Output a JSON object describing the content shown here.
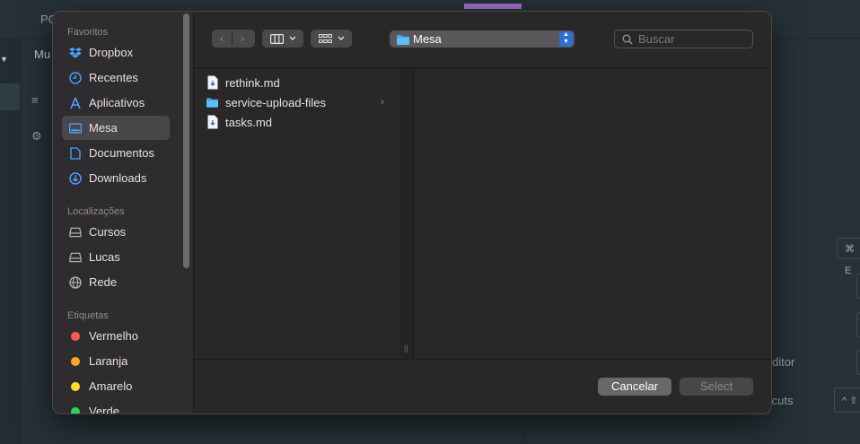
{
  "background": {
    "tab_label": "PC",
    "side_label": "Mu",
    "row1_label": "ditor",
    "row2_label": "tcuts",
    "kbd1": "⌘ E",
    "kbd2": "^ ⇧"
  },
  "dialog": {
    "toolbar": {
      "back_icon": "‹",
      "forward_icon": "›",
      "location": "Mesa",
      "search_placeholder": "Buscar"
    },
    "sidebar": {
      "sections": [
        {
          "title": "Favoritos",
          "items": [
            {
              "label": "Dropbox",
              "icon": "dropbox-icon"
            },
            {
              "label": "Recentes",
              "icon": "clock-icon"
            },
            {
              "label": "Aplicativos",
              "icon": "applications-icon"
            },
            {
              "label": "Mesa",
              "icon": "desktop-icon",
              "selected": true
            },
            {
              "label": "Documentos",
              "icon": "document-icon"
            },
            {
              "label": "Downloads",
              "icon": "download-icon"
            }
          ]
        },
        {
          "title": "Localizações",
          "items": [
            {
              "label": "Cursos",
              "icon": "drive-icon"
            },
            {
              "label": "Lucas",
              "icon": "drive-icon"
            },
            {
              "label": "Rede",
              "icon": "network-icon"
            }
          ]
        },
        {
          "title": "Etiquetas",
          "items": [
            {
              "label": "Vermelho",
              "color": "#ff5a52"
            },
            {
              "label": "Laranja",
              "color": "#ffa623"
            },
            {
              "label": "Amarelo",
              "color": "#ffde2a"
            },
            {
              "label": "Verde",
              "color": "#2fd158"
            }
          ]
        }
      ]
    },
    "files": [
      {
        "name": "rethink.md",
        "type": "file"
      },
      {
        "name": "service-upload-files",
        "type": "folder"
      },
      {
        "name": "tasks.md",
        "type": "file"
      }
    ],
    "buttons": {
      "cancel": "Cancelar",
      "select": "Select"
    }
  }
}
